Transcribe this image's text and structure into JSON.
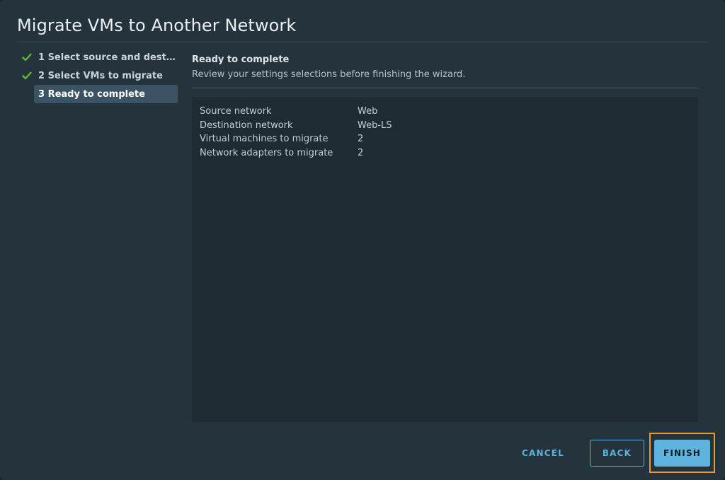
{
  "dialog": {
    "title": "Migrate VMs to Another Network"
  },
  "steps": [
    {
      "label": "1 Select source and destina...",
      "status": "complete",
      "icon": "check-icon"
    },
    {
      "label": "2 Select VMs to migrate",
      "status": "complete",
      "icon": "check-icon"
    },
    {
      "label": "3 Ready to complete",
      "status": "active"
    }
  ],
  "content": {
    "heading": "Ready to complete",
    "subheading": "Review your settings selections before finishing the wizard."
  },
  "summary": {
    "rows": [
      {
        "key": "Source network",
        "value": "Web"
      },
      {
        "key": "Destination network",
        "value": "Web-LS"
      },
      {
        "key": "Virtual machines to migrate",
        "value": "2"
      },
      {
        "key": "Network adapters to migrate",
        "value": "2"
      }
    ]
  },
  "footer": {
    "cancel_label": "CANCEL",
    "back_label": "BACK",
    "finish_label": "FINISH"
  },
  "colors": {
    "accent": "#5eb4de",
    "check": "#5fb837",
    "highlight": "#f0982a"
  }
}
